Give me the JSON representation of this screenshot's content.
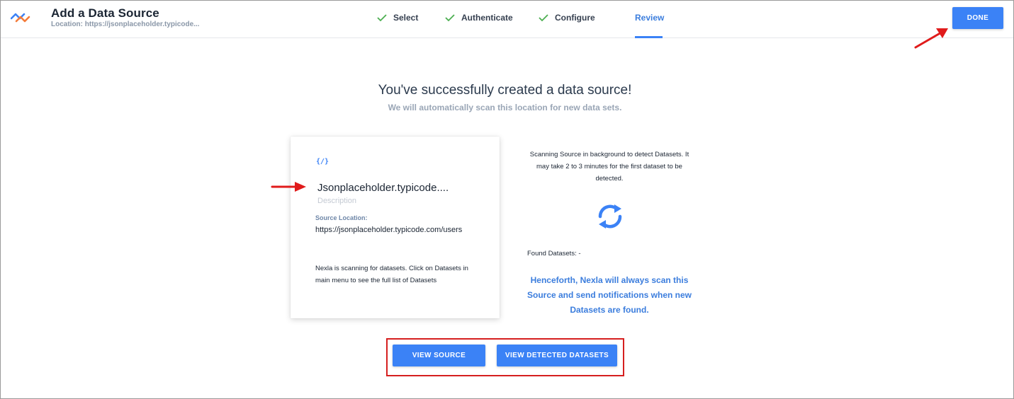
{
  "header": {
    "title": "Add a Data Source",
    "subtitle": "Location: https://jsonplaceholder.typicode...",
    "done_label": "DONE"
  },
  "steps": [
    {
      "label": "Select",
      "state": "completed"
    },
    {
      "label": "Authenticate",
      "state": "completed"
    },
    {
      "label": "Configure",
      "state": "completed"
    },
    {
      "label": "Review",
      "state": "active"
    }
  ],
  "main": {
    "title": "You've successfully created a data source!",
    "subtitle": "We will automatically scan this location for new data sets."
  },
  "card": {
    "icon": "code-icon",
    "icon_text": "{/}",
    "name": "Jsonplaceholder.typicode....",
    "description_placeholder": "Description",
    "location_label": "Source Location:",
    "location_value": "https://jsonplaceholder.typicode.com/users",
    "scan_note": "Nexla is scanning for datasets. Click on Datasets in main menu to see the full list of Datasets"
  },
  "scan": {
    "text": "Scanning Source in background to detect Datasets. It may take 2 to 3 minutes for the first dataset to be detected.",
    "found_label": "Found Datasets: -",
    "henceforth": "Henceforth, Nexla will always scan this Source and send notifications when new Datasets are found."
  },
  "actions": {
    "view_source": "VIEW SOURCE",
    "view_datasets": "VIEW DETECTED DATASETS"
  },
  "colors": {
    "accent": "#3b82f6",
    "check": "#4caf50",
    "annotation": "#d61f1f"
  }
}
